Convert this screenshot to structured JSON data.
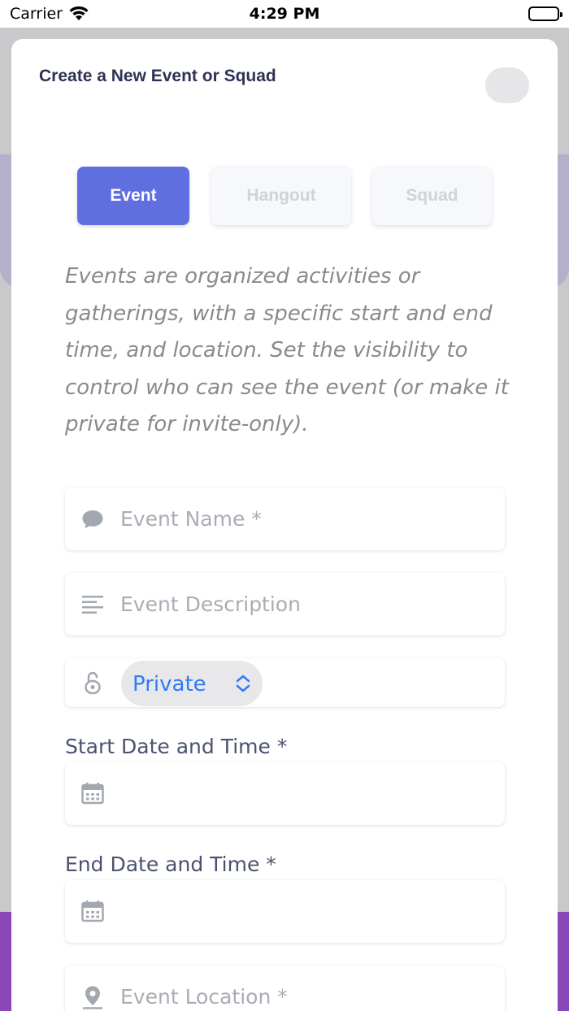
{
  "status_bar": {
    "carrier": "Carrier",
    "time": "4:29 PM",
    "battery_level": 1.0
  },
  "sheet": {
    "title": "Create a New Event or Squad"
  },
  "tabs": [
    {
      "label": "Event",
      "active": true
    },
    {
      "label": "Hangout",
      "active": false
    },
    {
      "label": "Squad",
      "active": false
    }
  ],
  "description": "Events are organized activities or gatherings, with a specific start and end time, and location. Set the visibility to control who can see the event (or make it private for invite-only).",
  "form": {
    "event_name": {
      "placeholder": "Event Name *",
      "icon": "chat-bubble-icon"
    },
    "event_description": {
      "placeholder": "Event Description",
      "icon": "text-lines-icon"
    },
    "visibility": {
      "value": "Private",
      "icon": "lock-icon"
    },
    "start_label": "Start Date and Time *",
    "start": {
      "icon": "calendar-icon"
    },
    "end_label": "End Date and Time *",
    "end": {
      "icon": "calendar-icon"
    },
    "location": {
      "placeholder": "Event Location *",
      "icon": "location-pin-icon"
    }
  },
  "colors": {
    "accent": "#5f6fe0",
    "title": "#2f3255",
    "select_value": "#2f7bf6",
    "placeholder": "#a9adb4",
    "purple_bar": "#8a47b8"
  }
}
